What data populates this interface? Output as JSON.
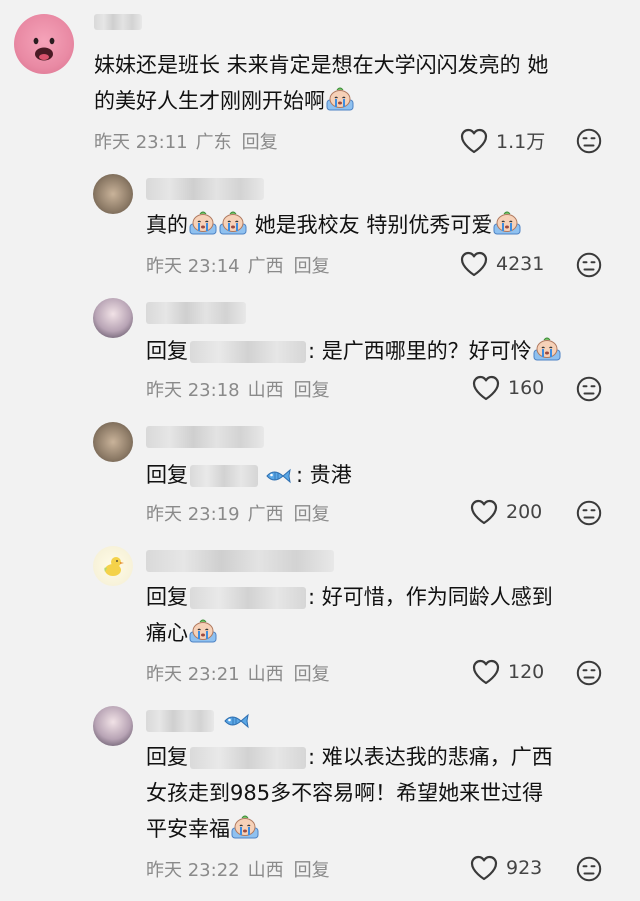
{
  "comments": [
    {
      "text_line1": "妹妹还是班长 未来肯定是想在大学闪闪发亮的 她",
      "text_line2": "的美好人生才刚刚开始啊",
      "time": "昨天 23:11",
      "location": "广东",
      "reply": "回复",
      "likes": "1.1万"
    },
    {
      "text_a": "真的",
      "text_b": "她是我校友 特别优秀可爱",
      "time": "昨天 23:14",
      "location": "广西",
      "reply": "回复",
      "likes": "4231"
    },
    {
      "reply_prefix": "回复",
      "text": ": 是广西哪里的？好可怜",
      "time": "昨天 23:18",
      "location": "山西",
      "reply": "回复",
      "likes": "160"
    },
    {
      "reply_prefix": "回复",
      "text": ": 贵港",
      "time": "昨天 23:19",
      "location": "广西",
      "reply": "回复",
      "likes": "200"
    },
    {
      "reply_prefix": "回复",
      "text_line1": ": 好可惜，作为同龄人感到",
      "text_line2": "痛心",
      "time": "昨天 23:21",
      "location": "山西",
      "reply": "回复",
      "likes": "120"
    },
    {
      "reply_prefix": "回复",
      "text_line1": ": 难以表达我的悲痛，广西",
      "text_line2": "女孩走到985多不容易啊！希望她来世过得",
      "text_line3": "平安幸福",
      "time": "昨天 23:22",
      "location": "山西",
      "reply": "回复",
      "likes": "923"
    }
  ],
  "icons": {
    "like": "heart-outline-icon",
    "dislike": "unhappy-face-icon",
    "emoji": "crying-emoji-icon",
    "fish": "blue-fish-icon"
  },
  "colors": {
    "background": "#f2f2f2",
    "meta_text": "#8a8a8a",
    "body_text": "#111111"
  }
}
